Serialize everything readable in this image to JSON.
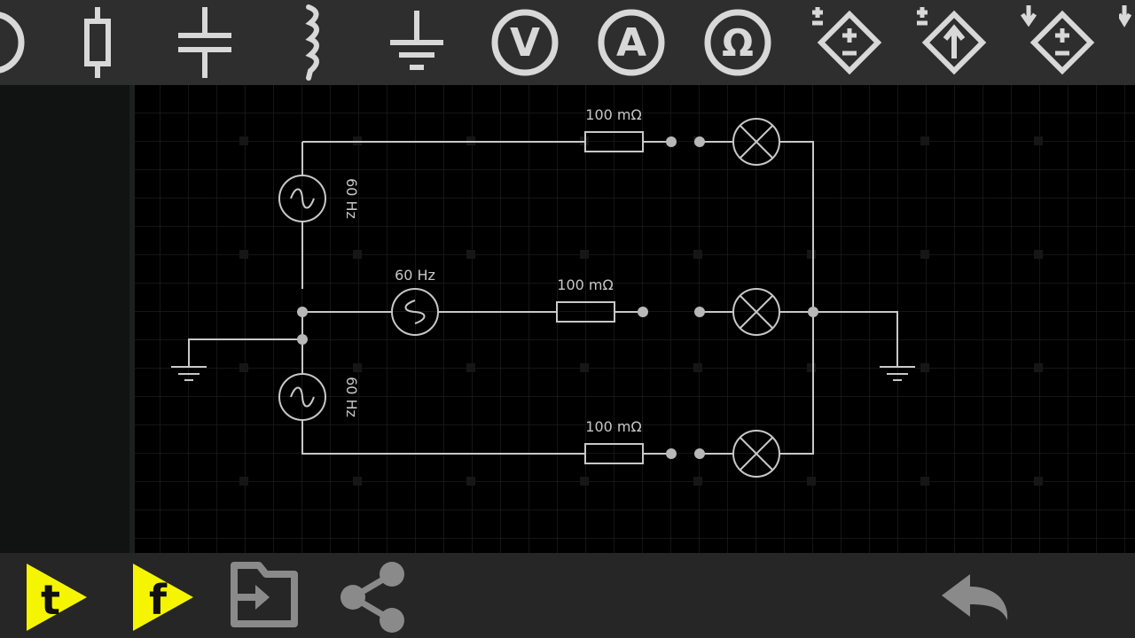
{
  "toolbar": {
    "tools": [
      {
        "icon": "ac-source-icon"
      },
      {
        "icon": "resistor-icon"
      },
      {
        "icon": "capacitor-icon"
      },
      {
        "icon": "inductor-icon"
      },
      {
        "icon": "ground-icon"
      },
      {
        "icon": "voltmeter-icon",
        "glyph": "V"
      },
      {
        "icon": "ammeter-icon",
        "glyph": "A"
      },
      {
        "icon": "ohmmeter-icon",
        "glyph": "Ω"
      },
      {
        "icon": "dependent-voltage-source-icon"
      },
      {
        "icon": "dependent-current-source-icon"
      },
      {
        "icon": "controlled-voltage-source-icon"
      },
      {
        "icon": "more-components-icon"
      }
    ]
  },
  "circuit": {
    "source_top_label": "60 Hz",
    "source_middle_label": "60 Hz",
    "source_bottom_label": "60 Hz",
    "resistor_top_label": "100 mΩ",
    "resistor_middle_label": "100 mΩ",
    "resistor_bottom_label": "100 mΩ"
  },
  "bottom_bar": {
    "tumblr_letter": "t",
    "facebook_letter": "f",
    "icons": [
      "tumblr-share-icon",
      "facebook-share-icon",
      "export-icon",
      "share-icon",
      "undo-icon"
    ],
    "accent_color": "#f5f500"
  },
  "colors": {
    "canvas": "#000000",
    "grid": "#1c1c1c",
    "wire": "#c8c8c8",
    "toolbar": "#2e2e2e",
    "icon": "#d8d8d8"
  }
}
